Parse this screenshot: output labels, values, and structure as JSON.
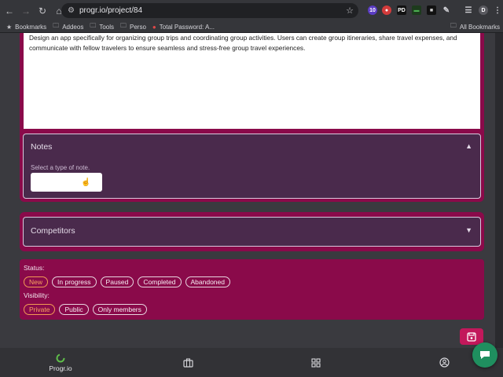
{
  "browser": {
    "url": "progr.io/project/84",
    "bookmarks": [
      {
        "label": "Bookmarks"
      },
      {
        "label": "Addeos"
      },
      {
        "label": "Tools"
      },
      {
        "label": "Perso"
      },
      {
        "label": "Total Password: A..."
      }
    ],
    "all_bookmarks": "All Bookmarks",
    "ext_badges": [
      "10",
      "PD",
      "D"
    ]
  },
  "description": {
    "text": "Design an app specifically for organizing group trips and coordinating group activities. Users can create group itineraries, share travel expenses, and communicate with fellow travelers to ensure seamless and stress-free group travel experiences."
  },
  "notes": {
    "title": "Notes",
    "select_label": "Select a type of note."
  },
  "competitors": {
    "title": "Competitors"
  },
  "status": {
    "label": "Status:",
    "options": [
      "New",
      "In progress",
      "Paused",
      "Completed",
      "Abandoned"
    ],
    "selected": "New"
  },
  "visibility": {
    "label": "Visibility:",
    "options": [
      "Private",
      "Public",
      "Only members"
    ],
    "selected": "Private"
  },
  "bottom_nav": {
    "home_label": "Progr.io"
  },
  "colors": {
    "accent": "#8a0a4a",
    "active_pill": "#f7a35f",
    "chat": "#1f8f5f"
  }
}
